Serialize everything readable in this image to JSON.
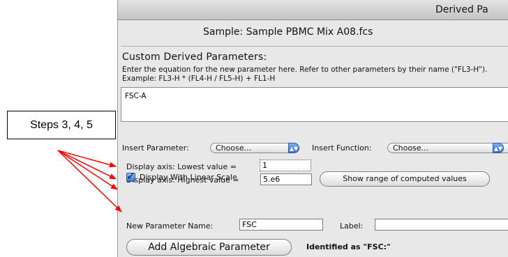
{
  "window": {
    "title": "Derived Pa"
  },
  "sample_label": "Sample: Sample PBMC Mix A08.fcs",
  "custom": {
    "heading": "Custom Derived Parameters:",
    "instructions": "Enter the equation for the new parameter here.  Refer to other parameters by their name (\"FL3-H\").  Example:  FL3-H * (FL4-H / FL5-H) + FL1-H",
    "equation": "FSC-A"
  },
  "insert_parameter": {
    "label": "Insert Parameter:",
    "value": "Choose..."
  },
  "insert_function": {
    "label": "Insert Function:",
    "value": "Choose..."
  },
  "axis_lowest": {
    "label": "Display axis: Lowest value =",
    "value": "1"
  },
  "axis_highest": {
    "label": "Display axis: Highest value =",
    "value": "5.e6"
  },
  "linear_scale": {
    "label": "Display With Linear Scale",
    "checked": true
  },
  "show_range_button": "Show range of computed values",
  "new_param": {
    "label": "New Parameter Name:",
    "value": "FSC"
  },
  "param_label": {
    "label": "Label:",
    "value": ""
  },
  "add_button": "Add Algebraic Parameter",
  "identified": "Identified as \"FSC:\"",
  "annotation": {
    "text": "Steps 3, 4, 5",
    "arrow_color": "#ff0000"
  }
}
